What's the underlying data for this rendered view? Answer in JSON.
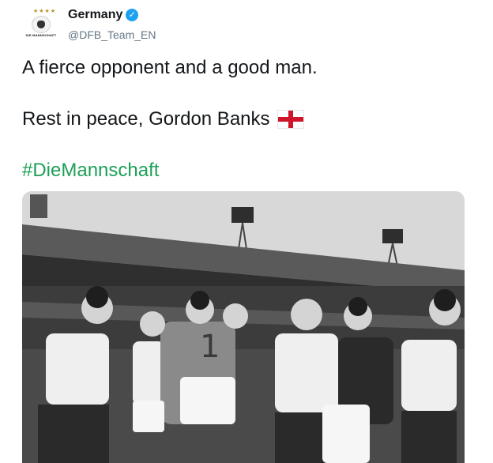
{
  "account": {
    "display_name": "Germany",
    "handle": "@DFB_Team_EN",
    "avatar_caption": "DIE MANNSCHAFT",
    "verified_icon": "verified-badge-icon"
  },
  "tweet": {
    "line1": "A fierce opponent and a good man.",
    "line2": "Rest in peace, Gordon Banks",
    "flag_icon": "england-flag-icon",
    "hashtag": "#DieMannschaft"
  },
  "colors": {
    "hashtag": "#1da057",
    "verified": "#1da1f2",
    "flag_cross": "#cf142b"
  }
}
